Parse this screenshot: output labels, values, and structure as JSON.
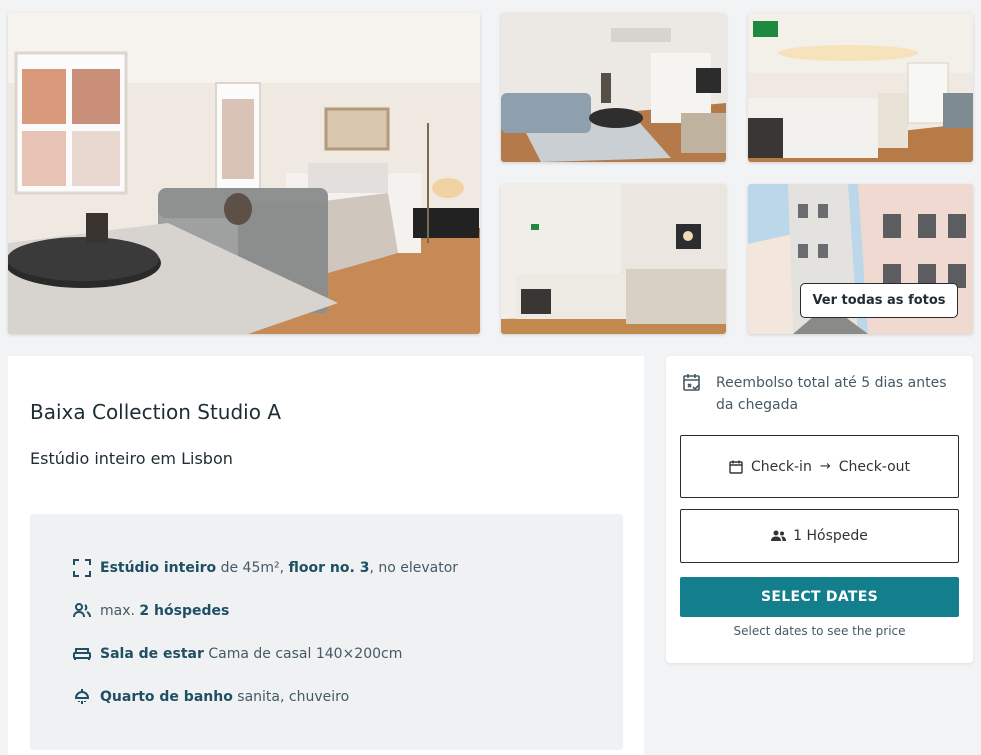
{
  "gallery": {
    "see_all_label": "Ver todas as fotos"
  },
  "listing": {
    "title": "Baixa Collection Studio A",
    "subtitle": "Estúdio inteiro em Lisbon",
    "features": [
      {
        "icon": "area-icon",
        "bold": "Estúdio inteiro",
        "text1": " de 45m², ",
        "bold2": "floor no. 3",
        "text2": ", no elevator"
      },
      {
        "icon": "guests-icon",
        "pre": "max. ",
        "bold": "2 hóspedes"
      },
      {
        "icon": "bed-icon",
        "bold": "Sala de estar",
        "text1": " Cama de casal 140×200cm"
      },
      {
        "icon": "shower-icon",
        "bold": "Quarto de banho",
        "text1": " sanita, chuveiro"
      }
    ]
  },
  "booking": {
    "refund_text": "Reembolso total até 5 dias antes da chegada",
    "checkin_label": "Check-in",
    "checkout_label": "Check-out",
    "guests_label": "1 Hóspede",
    "select_button": "SELECT DATES",
    "hint": "Select dates to see the price"
  },
  "colors": {
    "accent": "#147f8c",
    "feature_bold": "#1f4f63"
  }
}
